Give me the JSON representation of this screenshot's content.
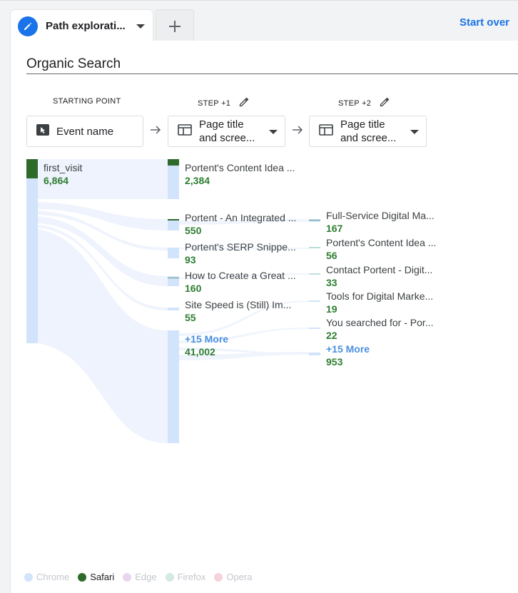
{
  "tab": {
    "label": "Path explorati...",
    "start_over": "Start over"
  },
  "title": "Organic Search",
  "steps": [
    {
      "header": "STARTING POINT",
      "selector": "Event name"
    },
    {
      "header": "STEP +1",
      "selector_line1": "Page title",
      "selector_line2": "and scree..."
    },
    {
      "header": "STEP +2",
      "selector_line1": "Page title",
      "selector_line2": "and scree..."
    }
  ],
  "start_node": {
    "label": "first_visit",
    "value": "6,864"
  },
  "step1_nodes": [
    {
      "label": "Portent's Content Idea ...",
      "value": "2,384"
    },
    {
      "label": "Portent - An Integrated ...",
      "value": "550"
    },
    {
      "label": "Portent's SERP Snippe...",
      "value": "93"
    },
    {
      "label": "How to Create a Great ...",
      "value": "160"
    },
    {
      "label": "Site Speed is (Still) Im...",
      "value": "55"
    }
  ],
  "step1_more": {
    "label": "+15 More",
    "value": "41,002"
  },
  "step2_nodes": [
    {
      "label": "Full-Service Digital Ma...",
      "value": "167"
    },
    {
      "label": "Portent's Content Idea ...",
      "value": "56"
    },
    {
      "label": "Contact Portent - Digit...",
      "value": "33"
    },
    {
      "label": "Tools for Digital Marke...",
      "value": "19"
    },
    {
      "label": "You searched for - Por...",
      "value": "22"
    }
  ],
  "step2_more": {
    "label": "+15 More",
    "value": "953"
  },
  "legend": [
    {
      "label": "Chrome",
      "color": "#d2e3fc",
      "active": false
    },
    {
      "label": "Safari",
      "color": "#2e6b2a",
      "active": true
    },
    {
      "label": "Edge",
      "color": "#e8d5f0",
      "active": false
    },
    {
      "label": "Firefox",
      "color": "#d4e8e4",
      "active": false
    },
    {
      "label": "Opera",
      "color": "#f5d3da",
      "active": false
    }
  ],
  "colors": {
    "accent": "#1a73e8",
    "value_green": "#2e7d32",
    "bar_blue": "#d2e3fc",
    "bar_green": "#2e6b2a"
  }
}
